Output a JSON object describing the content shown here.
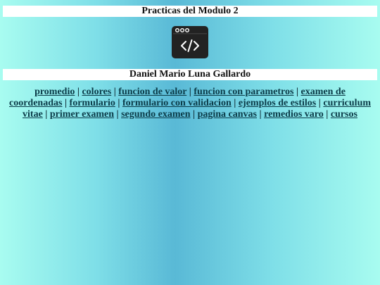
{
  "header": {
    "title": "Practicas del Modulo 2",
    "author": "Daniel Mario Luna Gallardo"
  },
  "logo": {
    "icon": "code-window-icon",
    "color": "#222222"
  },
  "nav": {
    "separator": " | ",
    "links": [
      "promedio",
      "colores",
      "funcion de valor",
      "funcion con parametros",
      "examen de coordenadas",
      "formulario",
      "formulario con validacion",
      "ejemplos de estilos",
      "curriculum vitae",
      "primer examen",
      "segundo examen",
      "pagina canvas",
      "remedios varo",
      "cursos"
    ]
  },
  "colors": {
    "background_edge": "#a8fcf0",
    "background_center": "#59b9d6",
    "link": "#0b3b48"
  }
}
